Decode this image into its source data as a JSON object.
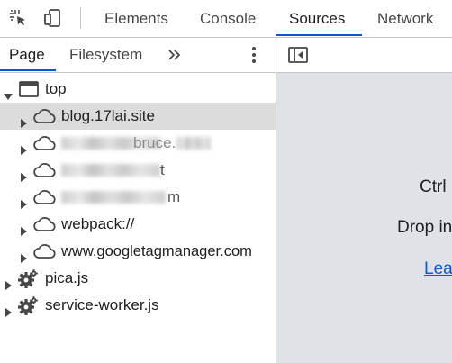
{
  "toolbar": {
    "inspect_icon": "inspect-element-icon",
    "device_icon": "device-toolbar-icon",
    "tabs": [
      {
        "label": "Elements"
      },
      {
        "label": "Console"
      },
      {
        "label": "Sources"
      },
      {
        "label": "Network"
      }
    ],
    "active_tab": "Sources",
    "accent_color": "#0b57d0"
  },
  "navigator": {
    "tabs": [
      {
        "label": "Page"
      },
      {
        "label": "Filesystem"
      }
    ],
    "active_tab": "Page",
    "more_tabs_icon": "double-chevron-right-icon",
    "menu_icon": "more-vert-icon",
    "tree": [
      {
        "label": "top",
        "icon": "frame-icon",
        "expanded": true
      },
      {
        "label": "blog.17lai.site",
        "icon": "cloud-icon",
        "selected": true
      },
      {
        "label": "bruce.",
        "icon": "cloud-icon",
        "obscured": true
      },
      {
        "label": "t",
        "icon": "cloud-icon",
        "obscured": true
      },
      {
        "label": "m",
        "icon": "cloud-icon",
        "obscured": true
      },
      {
        "label": "webpack://",
        "icon": "cloud-icon"
      },
      {
        "label": "www.googletagmanager.com",
        "icon": "cloud-icon"
      },
      {
        "label": "pica.js",
        "icon": "gear-icon"
      },
      {
        "label": "service-worker.js",
        "icon": "gear-icon"
      }
    ]
  },
  "editor": {
    "toggle_icon": "show-navigator-icon",
    "hints": [
      "Ctrl",
      "Drop in",
      "Lea"
    ],
    "background": "#dfe3e8"
  }
}
